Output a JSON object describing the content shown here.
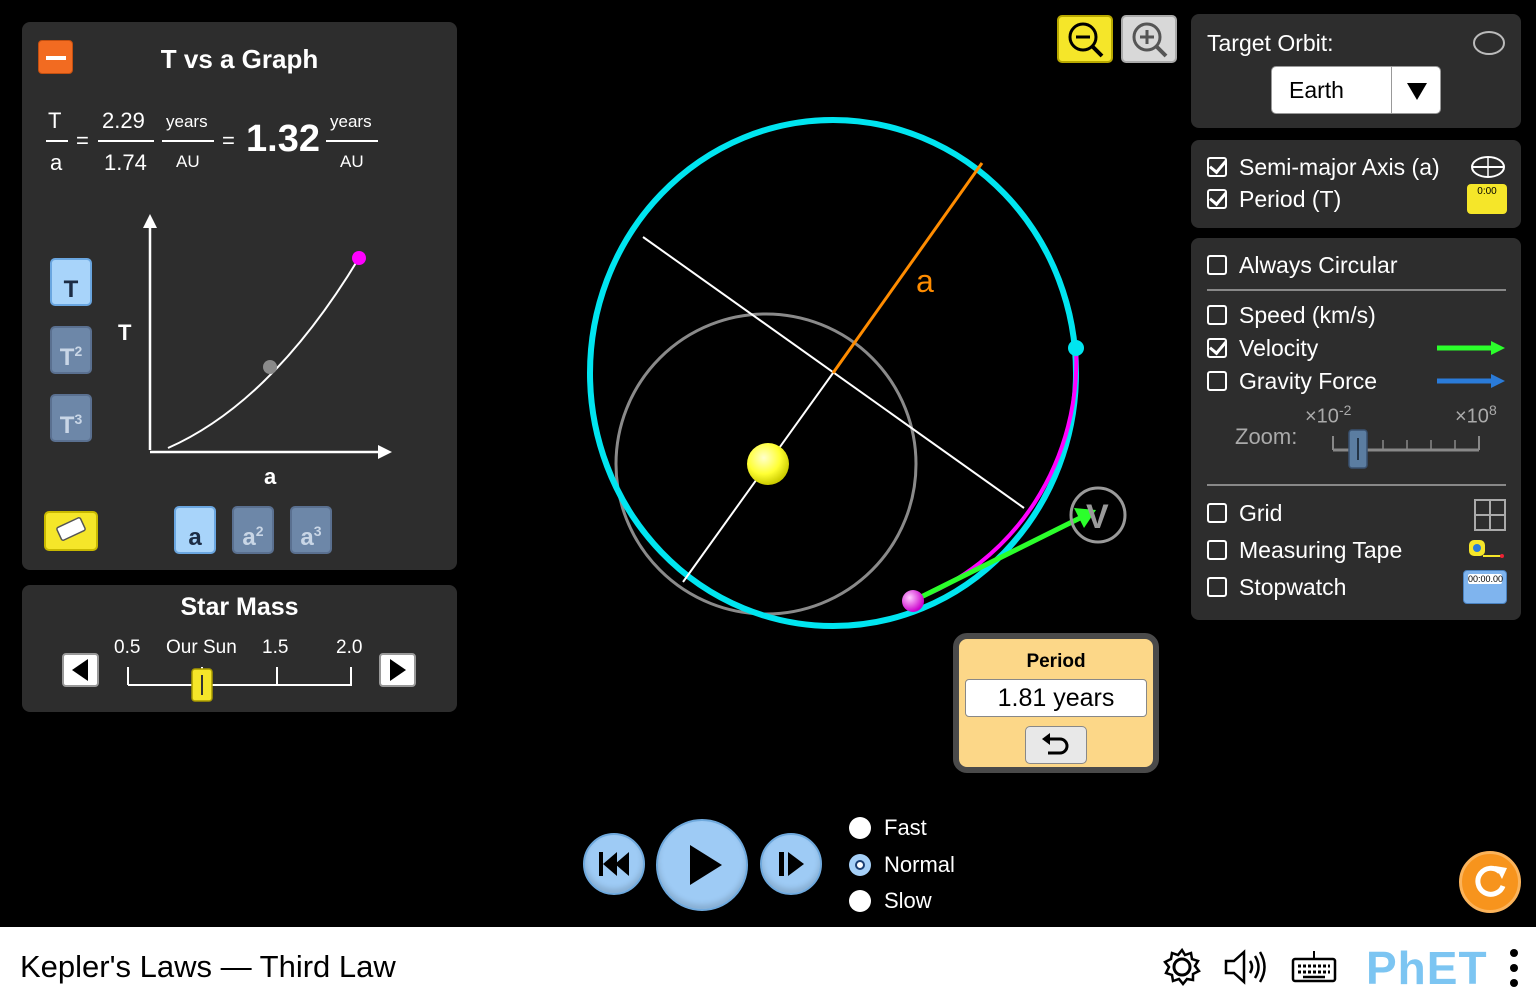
{
  "graph_panel": {
    "title": "T vs a Graph",
    "eq_t": "T",
    "eq_a": "a",
    "eq_eq1": "=",
    "eq_num": "2.29",
    "eq_den": "1.74",
    "eq_unit_top": "years",
    "eq_unit_bot": "AU",
    "eq_eq2": "=",
    "eq_result": "1.32",
    "eq_res_unit_top": "years",
    "eq_res_unit_bot": "AU",
    "y_axis_label": "T",
    "x_axis_label": "a",
    "t_buttons": [
      {
        "base": "T",
        "exp": "",
        "selected": true
      },
      {
        "base": "T",
        "exp": "2",
        "selected": false
      },
      {
        "base": "T",
        "exp": "3",
        "selected": false
      }
    ],
    "a_buttons": [
      {
        "base": "a",
        "exp": "",
        "selected": true
      },
      {
        "base": "a",
        "exp": "2",
        "selected": false
      },
      {
        "base": "a",
        "exp": "3",
        "selected": false
      }
    ]
  },
  "star_mass": {
    "title": "Star Mass",
    "ticks": [
      "0.5",
      "Our Sun",
      "1.5",
      "2.0"
    ],
    "value_label": "Our Sun"
  },
  "target_orbit": {
    "label": "Target Orbit:",
    "selected": "Earth"
  },
  "visibility": {
    "semi_major": {
      "label": "Semi-major Axis (a)",
      "checked": true
    },
    "period": {
      "label": "Period (T)",
      "checked": true
    },
    "period_icon_text": "0:00"
  },
  "options": {
    "always_circular": {
      "label": "Always Circular",
      "checked": false
    },
    "speed": {
      "label": "Speed (km/s)",
      "checked": false
    },
    "velocity": {
      "label": "Velocity",
      "checked": true
    },
    "gravity": {
      "label": "Gravity Force",
      "checked": false
    },
    "zoom_label": "Zoom:",
    "zoom_min": "×10",
    "zoom_min_exp": "-2",
    "zoom_max": "×10",
    "zoom_max_exp": "8",
    "grid": {
      "label": "Grid",
      "checked": false
    },
    "measuring_tape": {
      "label": "Measuring Tape",
      "checked": false
    },
    "stopwatch": {
      "label": "Stopwatch",
      "checked": false
    },
    "stopwatch_icon_text": "00:00.00"
  },
  "orbit": {
    "axis_label": "a",
    "velocity_label": "V"
  },
  "period_box": {
    "title": "Period",
    "value": "1.81 years"
  },
  "playback": {
    "speeds": [
      {
        "label": "Fast",
        "selected": false
      },
      {
        "label": "Normal",
        "selected": true
      },
      {
        "label": "Slow",
        "selected": false
      }
    ]
  },
  "navbar": {
    "title": "Kepler's Laws — Third Law",
    "logo": "PhET"
  },
  "colors": {
    "orbit": "#00e5f0",
    "orbit_path": "#ff00ff",
    "semi_major": "#ff8c00",
    "velocity": "#2bff2b",
    "gravity": "#2a7bd9",
    "sun": "#ffff33",
    "accent_yellow": "#f5e629"
  }
}
